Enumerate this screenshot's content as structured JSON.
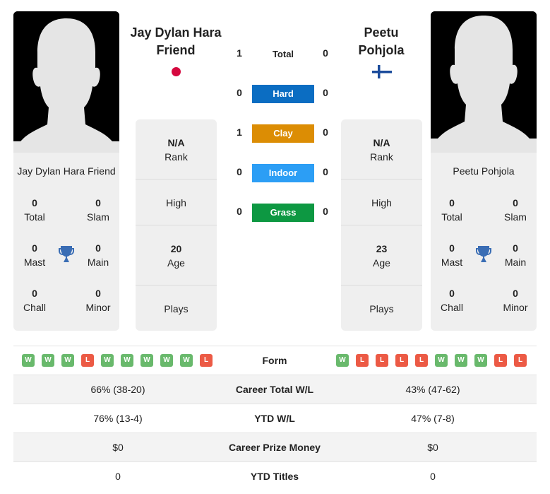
{
  "colors": {
    "hard": "#0b6dc2",
    "clay": "#dc8d04",
    "indoor": "#2c9ef5",
    "grass": "#0d9842",
    "win": "#69b96c",
    "loss": "#ec5a45",
    "trophy": "#3a6db4"
  },
  "player1": {
    "name": "Jay Dylan Hara Friend",
    "name_line1": "Jay Dylan Hara",
    "name_line2": "Friend",
    "flag": "japan-flag",
    "stats": {
      "total": {
        "value": "0",
        "label": "Total"
      },
      "slam": {
        "value": "0",
        "label": "Slam"
      },
      "mast": {
        "value": "0",
        "label": "Mast"
      },
      "main": {
        "value": "0",
        "label": "Main"
      },
      "chall": {
        "value": "0",
        "label": "Chall"
      },
      "minor": {
        "value": "0",
        "label": "Minor"
      }
    },
    "rank": {
      "value": "N/A",
      "label": "Rank"
    },
    "high": {
      "label": "High"
    },
    "age": {
      "value": "20",
      "label": "Age"
    },
    "plays": {
      "label": "Plays"
    },
    "form": [
      "W",
      "W",
      "W",
      "L",
      "W",
      "W",
      "W",
      "W",
      "W",
      "L"
    ]
  },
  "player2": {
    "name": "Peetu Pohjola",
    "name_line1": "Peetu",
    "name_line2": "Pohjola",
    "flag": "finland-flag",
    "stats": {
      "total": {
        "value": "0",
        "label": "Total"
      },
      "slam": {
        "value": "0",
        "label": "Slam"
      },
      "mast": {
        "value": "0",
        "label": "Mast"
      },
      "main": {
        "value": "0",
        "label": "Main"
      },
      "chall": {
        "value": "0",
        "label": "Chall"
      },
      "minor": {
        "value": "0",
        "label": "Minor"
      }
    },
    "rank": {
      "value": "N/A",
      "label": "Rank"
    },
    "high": {
      "label": "High"
    },
    "age": {
      "value": "23",
      "label": "Age"
    },
    "plays": {
      "label": "Plays"
    },
    "form": [
      "W",
      "L",
      "L",
      "L",
      "L",
      "W",
      "W",
      "W",
      "L",
      "L"
    ]
  },
  "h2h": [
    {
      "label": "Total",
      "p1": "1",
      "p2": "0"
    },
    {
      "label": "Hard",
      "p1": "0",
      "p2": "0"
    },
    {
      "label": "Clay",
      "p1": "1",
      "p2": "0"
    },
    {
      "label": "Indoor",
      "p1": "0",
      "p2": "0"
    },
    {
      "label": "Grass",
      "p1": "0",
      "p2": "0"
    }
  ],
  "comparison": {
    "form_label": "Form",
    "rows": [
      {
        "label": "Career Total W/L",
        "p1": "66% (38-20)",
        "p2": "43% (47-62)"
      },
      {
        "label": "YTD W/L",
        "p1": "76% (13-4)",
        "p2": "47% (7-8)"
      },
      {
        "label": "Career Prize Money",
        "p1": "$0",
        "p2": "$0"
      },
      {
        "label": "YTD Titles",
        "p1": "0",
        "p2": "0"
      }
    ]
  }
}
